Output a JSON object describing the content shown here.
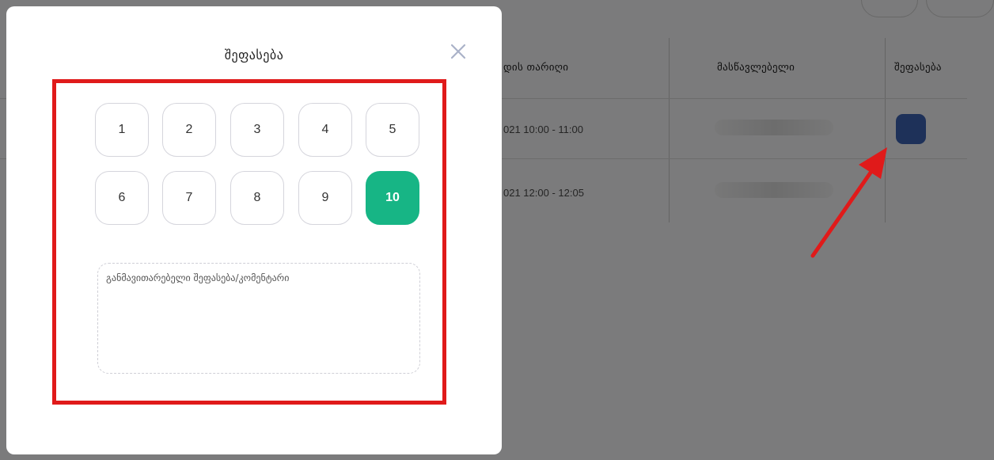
{
  "modal": {
    "title": "შეფასება",
    "scores": [
      "1",
      "2",
      "3",
      "4",
      "5",
      "6",
      "7",
      "8",
      "9",
      "10"
    ],
    "selected_score": "10",
    "comment_placeholder": "განმავითარებელი შეფასება/კომენტარი"
  },
  "table": {
    "headers": {
      "date": "დის თარიღი",
      "teacher": "მასწავლებელი",
      "rating": "შეფასება"
    },
    "rows": [
      {
        "time": "021 10:00 - 11:00"
      },
      {
        "time": "021 12:00 - 12:05"
      }
    ]
  },
  "colors": {
    "selected_score": "#17b585",
    "rate_button": "#3d62b2",
    "highlight": "#e01a1a",
    "arrow": "#e01a1a"
  },
  "icons": [
    "close-icon",
    "arrow-annotation"
  ]
}
